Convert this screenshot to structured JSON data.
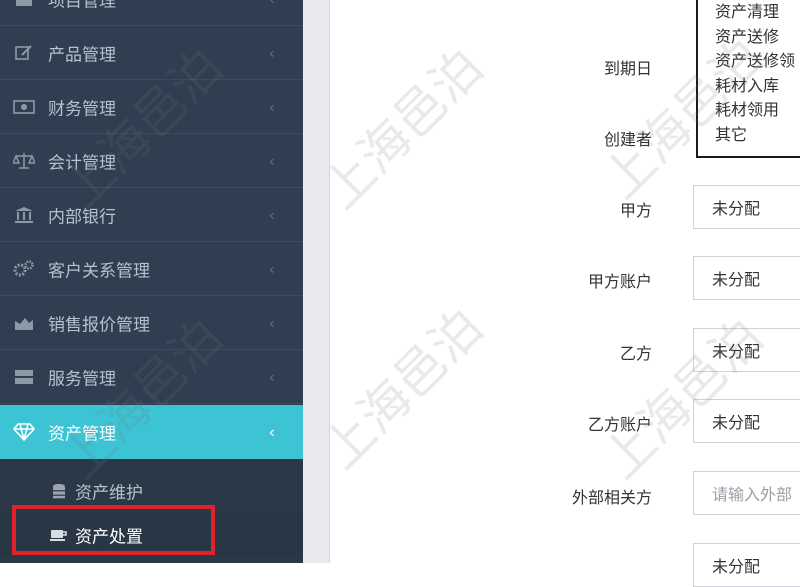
{
  "sidebar": {
    "items": [
      {
        "label": "项目管理",
        "icon": "briefcase-icon"
      },
      {
        "label": "产品管理",
        "icon": "edit-icon"
      },
      {
        "label": "财务管理",
        "icon": "money-icon"
      },
      {
        "label": "会计管理",
        "icon": "scale-icon"
      },
      {
        "label": "内部银行",
        "icon": "bank-icon"
      },
      {
        "label": "客户关系管理",
        "icon": "gears-icon"
      },
      {
        "label": "销售报价管理",
        "icon": "chart-icon"
      },
      {
        "label": "服务管理",
        "icon": "server-icon"
      },
      {
        "label": "资产管理",
        "icon": "diamond-icon"
      }
    ],
    "sub_items": [
      {
        "label": "资产维护",
        "icon": "database-icon"
      },
      {
        "label": "资产处置",
        "icon": "coffee-icon"
      }
    ],
    "chevron": "‹"
  },
  "form": {
    "fields": [
      {
        "label": "到期日"
      },
      {
        "label": "创建者"
      },
      {
        "label": "甲方",
        "value": "未分配"
      },
      {
        "label": "甲方账户",
        "value": "未分配"
      },
      {
        "label": "乙方",
        "value": "未分配"
      },
      {
        "label": "乙方账户",
        "value": "未分配"
      },
      {
        "label": "外部相关方",
        "placeholder": "请输入外部"
      },
      {
        "label": "",
        "value": "未分配"
      }
    ],
    "dropdown_options": [
      "资产清理",
      "资产送修",
      "资产送修领",
      "耗材入库",
      "耗材领用",
      "其它"
    ]
  },
  "watermark": "上海邑泊",
  "colors": {
    "accent": "#3cc3d4",
    "sidebar_bg": "#2f3f51",
    "highlight": "#e0222a"
  }
}
